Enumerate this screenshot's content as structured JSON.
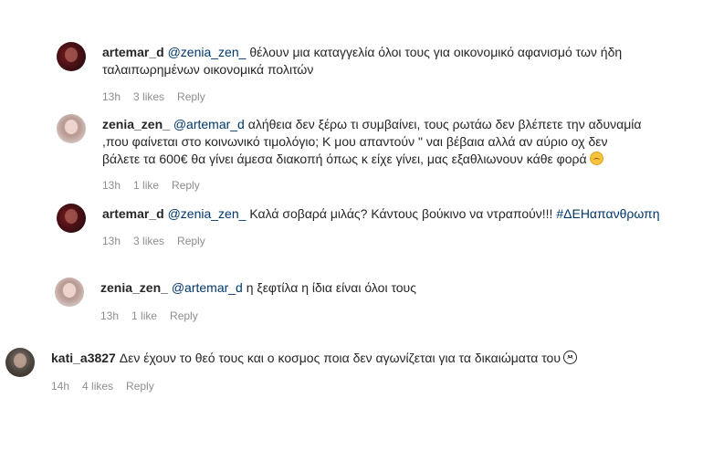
{
  "comments": [
    {
      "user": "artemar_d",
      "mention": "@zenia_zen_",
      "text_lines": [
        "θέλουν μια καταγγελία όλοι τους για οικονομικό αφανισμό των ήδη",
        "ταλαιπωρημένων οικονομικά πολιτών"
      ],
      "time": "13h",
      "likes": "3 likes",
      "reply": "Reply"
    },
    {
      "user": "zenia_zen_",
      "mention": "@artemar_d",
      "text_lines": [
        "αλήθεια δεν ξέρω τι συμβαίνει, τους ρωτάω δεν βλέπετε την αδυναμία",
        ",που φαίνεται στο κοινωνικό τιμολόγιο; Κ μου απαντούν \" ναι βέβαια αλλά αν αύριο οχ δεν",
        "βάλετε τα 600€ θα γίνει άμεσα διακοπή όπως κ είχε γίνει, μας εξαθλιωνουν κάθε φορά"
      ],
      "emoji": "disappointed-face",
      "time": "13h",
      "likes": "1 like",
      "reply": "Reply"
    },
    {
      "user": "artemar_d",
      "mention": "@zenia_zen_",
      "text": "Καλά σοβαρά μιλάς? Κάντους βούκινο να ντραπούν!!!",
      "hashtag": "#ΔΕΗαπανθρωπη",
      "time": "13h",
      "likes": "3 likes",
      "reply": "Reply"
    },
    {
      "user": "zenia_zen_",
      "mention": "@artemar_d",
      "text": "η ξεφτίλα η ίδια είναι όλοι τους",
      "time": "13h",
      "likes": "1 like",
      "reply": "Reply"
    },
    {
      "user": "kati_a3827",
      "text": "Δεν έχουν το θεό τους και ο κοσμος ποια δεν αγωνίζεται για τα δικαιώματα του",
      "emoji": "frowning-face",
      "time": "14h",
      "likes": "4 likes",
      "reply": "Reply"
    }
  ]
}
